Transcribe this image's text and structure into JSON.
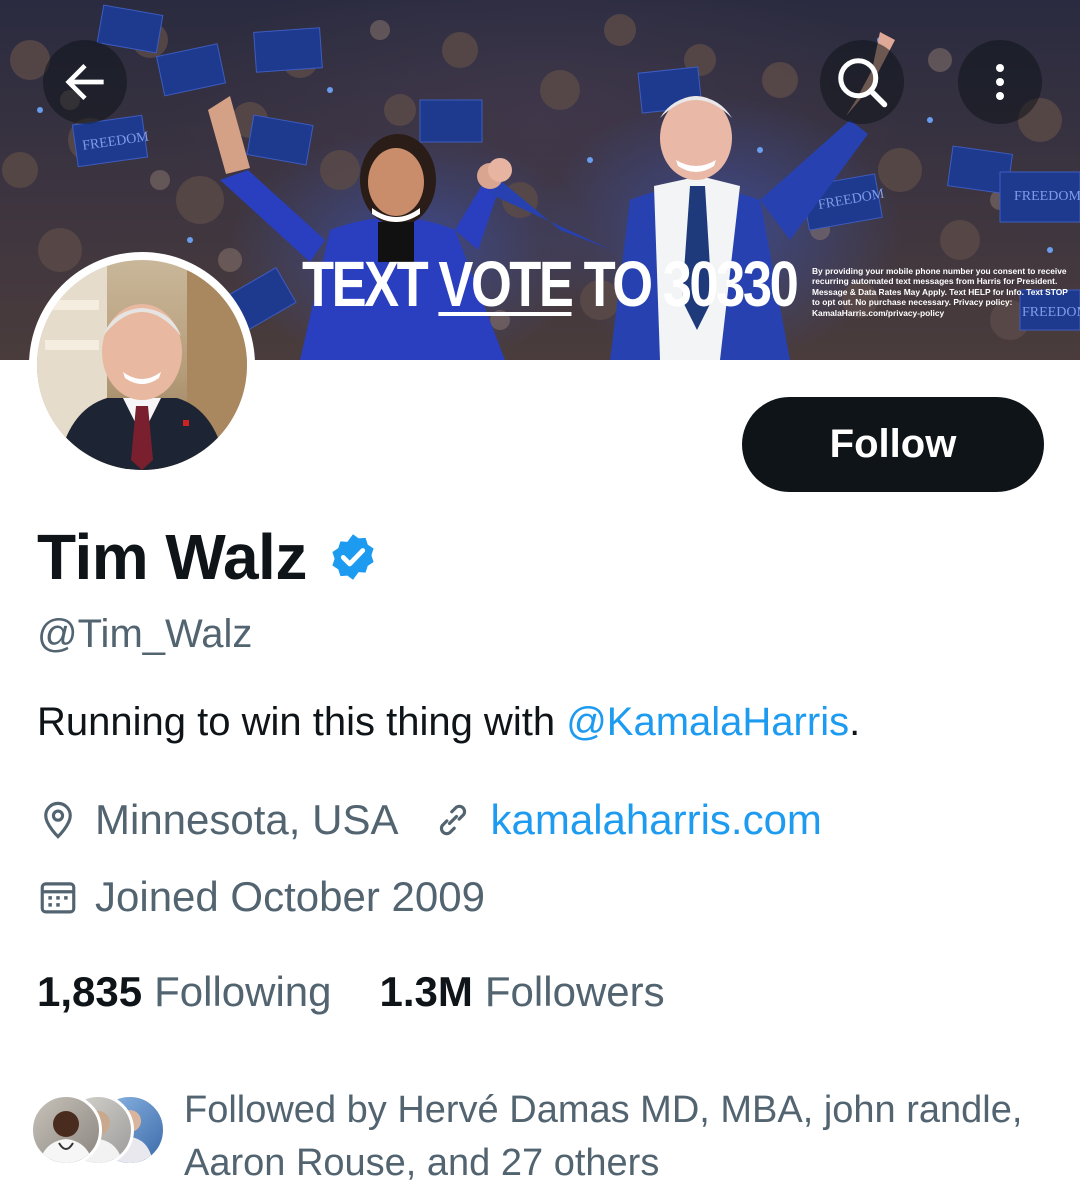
{
  "banner": {
    "headline_pre": "TEXT ",
    "headline_vote": "VOTE",
    "headline_post": " TO 30330",
    "disclaimer": "By providing your mobile phone number you consent to receive recurring automated text messages from Harris for President. Message & Data Rates May Apply. Text HELP for Info. Text STOP to opt out. No purchase necessary. Privacy policy: KamalaHarris.com/privacy-policy",
    "sign_text": "FREEDOM"
  },
  "nav": {
    "back_icon": "arrow-left-icon",
    "search_icon": "search-icon",
    "more_icon": "more-vertical-icon"
  },
  "profile": {
    "name": "Tim Walz",
    "handle": "@Tim_Walz",
    "bio_text": "Running to win this thing with ",
    "bio_mention": "@KamalaHarris",
    "bio_end": ".",
    "location": "Minnesota, USA",
    "website": "kamalaharris.com",
    "joined": "Joined October 2009",
    "follow_label": "Follow",
    "verified_color": "#1d9bf0"
  },
  "stats": {
    "following_count": "1,835",
    "following_label": "Following",
    "followers_count": "1.3M",
    "followers_label": "Followers"
  },
  "followed_by": {
    "text": "Followed by Hervé Damas MD, MBA, john randle, Aaron Rouse, and 27 others"
  },
  "colors": {
    "text_primary": "#0f1419",
    "text_secondary": "#536471",
    "accent": "#1d9bf0",
    "button_dark": "#0f1419"
  }
}
